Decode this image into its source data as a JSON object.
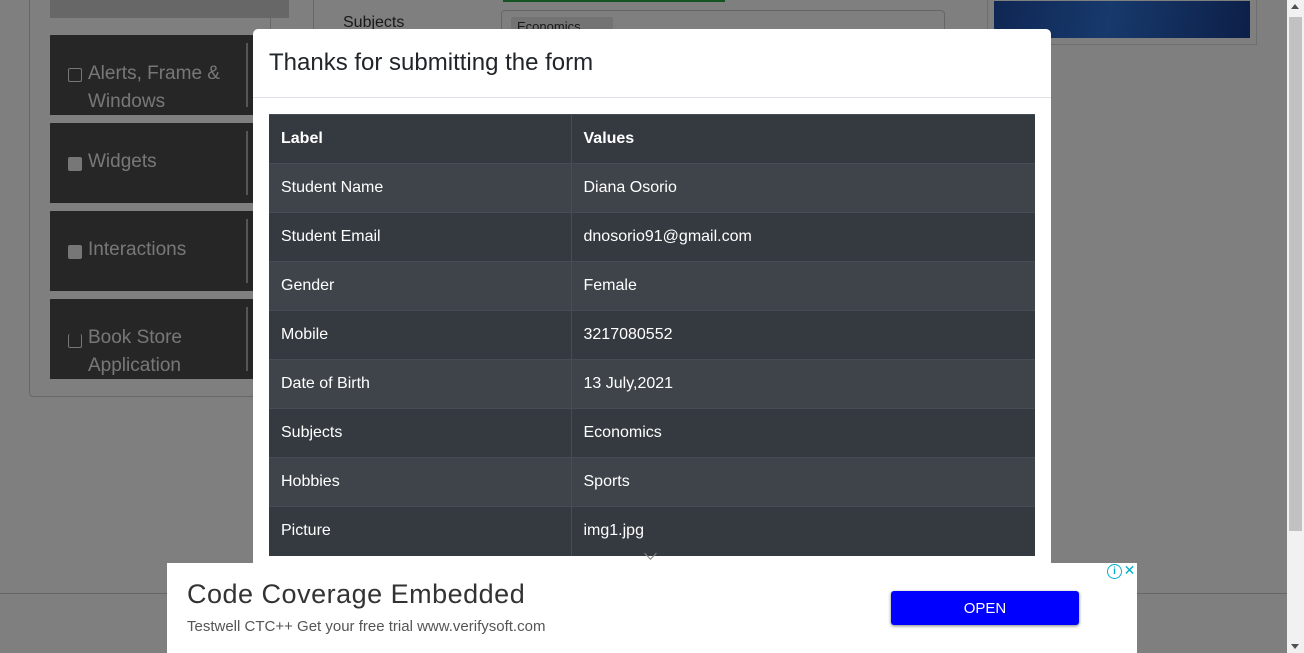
{
  "background": {
    "sidebar": [
      {
        "label_line1": "Alerts, Frame &",
        "label_line2": "Windows",
        "icon": "window-icon"
      },
      {
        "label_line1": "Widgets",
        "label_line2": "",
        "icon": "widgets-icon"
      },
      {
        "label_line1": "Interactions",
        "label_line2": "",
        "icon": "interactions-icon"
      },
      {
        "label_line1": "Book Store",
        "label_line2": "Application",
        "icon": "books-icon"
      }
    ],
    "subjects_label": "Subjects",
    "subject_chip": "Economics"
  },
  "modal": {
    "title": "Thanks for submitting the form",
    "headers": [
      "Label",
      "Values"
    ],
    "rows": [
      {
        "label": "Student Name",
        "value": "Diana Osorio"
      },
      {
        "label": "Student Email",
        "value": "dnosorio91@gmail.com"
      },
      {
        "label": "Gender",
        "value": "Female"
      },
      {
        "label": "Mobile",
        "value": "3217080552"
      },
      {
        "label": "Date of Birth",
        "value": "13 July,2021"
      },
      {
        "label": "Subjects",
        "value": "Economics"
      },
      {
        "label": "Hobbies",
        "value": "Sports"
      },
      {
        "label": "Picture",
        "value": "img1.jpg"
      }
    ]
  },
  "ad": {
    "title": "Code Coverage Embedded",
    "subtitle": "Testwell CTC++ Get your free trial www.verifysoft.com",
    "button_label": "OPEN",
    "info_glyph": "i",
    "close_glyph": "✕"
  },
  "colors": {
    "table_dark": "#343a40",
    "table_stripe": "#3e444a",
    "ad_button": "#0000ff",
    "sidebar_bg": "#4d4d4d"
  }
}
